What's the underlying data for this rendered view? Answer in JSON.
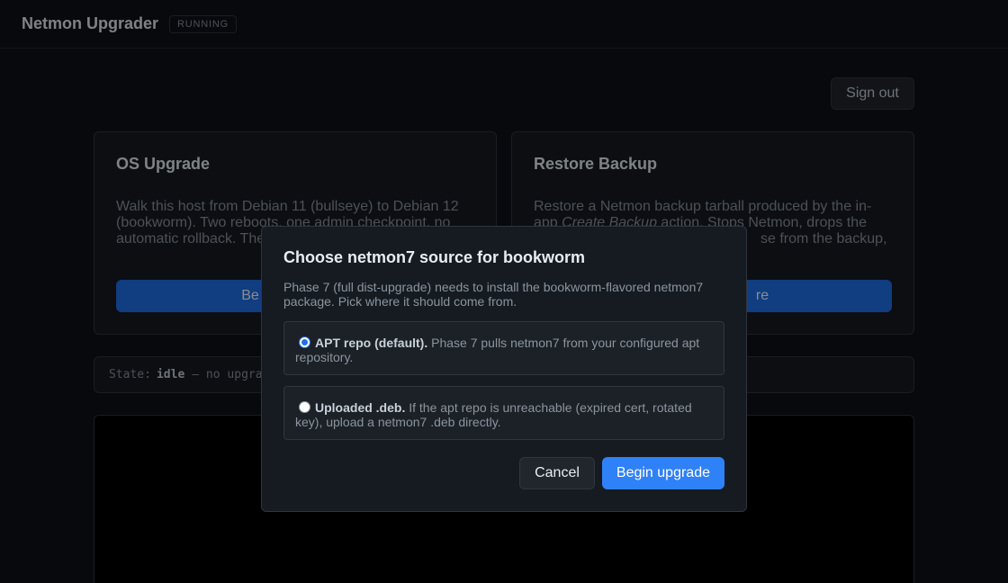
{
  "header": {
    "app_title": "Netmon Upgrader",
    "status": "RUNNING",
    "sign_out": "Sign out"
  },
  "cards": [
    {
      "title": "OS Upgrade",
      "description": "Walk this host from Debian 11 (bullseye) to Debian 12 (bookworm). Two reboots, one admin checkpoint, no automatic rollback. The",
      "button": "Be"
    },
    {
      "title": "Restore Backup",
      "description_prefix": "Restore a Netmon backup tarball produced by the in-app ",
      "description_italic": "Create Backup",
      "description_suffix": " action. Stops Netmon, drops the",
      "description_line3": "se from the backup,",
      "button": "re"
    }
  ],
  "state_bar": {
    "label": "State:",
    "value": "idle",
    "detail": "— no upgra"
  },
  "modal": {
    "title": "Choose netmon7 source for bookworm",
    "description": "Phase 7 (full dist-upgrade) needs to install the bookworm-flavored netmon7 package. Pick where it should come from.",
    "options": [
      {
        "label": "APT repo (default).",
        "text": " Phase 7 pulls netmon7 from your configured apt repository.",
        "checked": true
      },
      {
        "label": "Uploaded .deb.",
        "text": " If the apt repo is unreachable (expired cert, rotated key), upload a netmon7 .deb directly.",
        "checked": false
      }
    ],
    "cancel": "Cancel",
    "confirm": "Begin upgrade"
  },
  "colors": {
    "background": "#0d1117",
    "primary": "#2f81f7",
    "card": "#161b22"
  }
}
